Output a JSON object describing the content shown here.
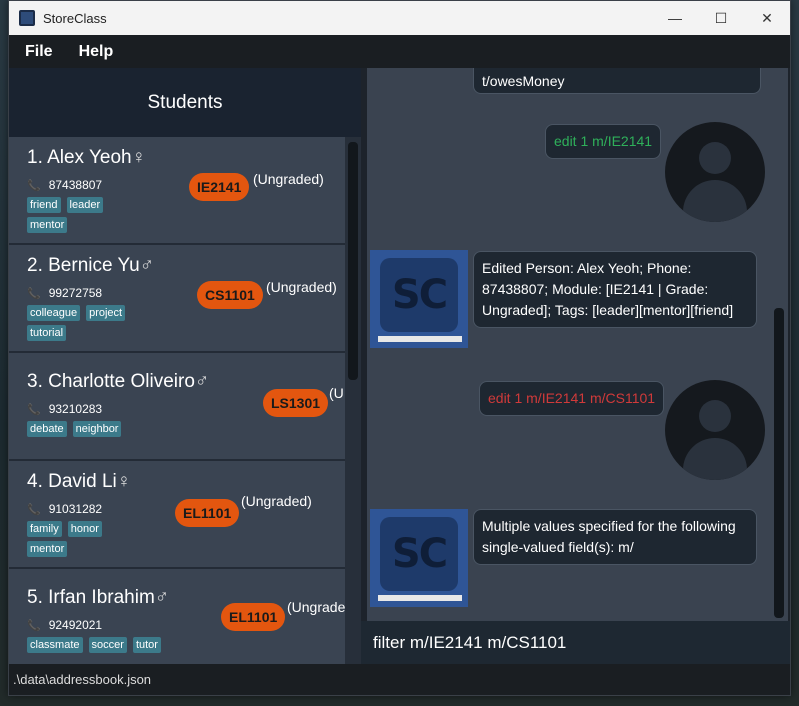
{
  "window": {
    "title": "StoreClass",
    "minimize": "—",
    "maximize": "☐",
    "close": "✕"
  },
  "menu": {
    "file": "File",
    "help": "Help"
  },
  "left": {
    "header": "Students"
  },
  "students": [
    {
      "name": "1. Alex Yeoh",
      "gender": "♀",
      "phone": "87438807",
      "tags": [
        "friend",
        "leader",
        "mentor"
      ],
      "module": "IE2141",
      "grade": "(Ungraded)"
    },
    {
      "name": "2. Bernice Yu",
      "gender": "♂",
      "phone": "99272758",
      "tags": [
        "colleague",
        "project",
        "tutorial"
      ],
      "module": "CS1101",
      "grade": "(Ungraded)"
    },
    {
      "name": "3. Charlotte Oliveiro",
      "gender": "♂",
      "phone": "93210283",
      "tags": [
        "debate",
        "neighbor"
      ],
      "module": "LS1301",
      "grade": "(U"
    },
    {
      "name": "4. David Li",
      "gender": "♀",
      "phone": "91031282",
      "tags": [
        "family",
        "honor",
        "mentor"
      ],
      "module": "EL1101",
      "grade": "(Ungraded)"
    },
    {
      "name": "5. Irfan Ibrahim",
      "gender": "♂",
      "phone": "92492021",
      "tags": [
        "classmate",
        "soccer",
        "tutor"
      ],
      "module": "EL1101",
      "grade": "(Ungrade"
    }
  ],
  "chat": {
    "msg_top": "t/owesMoney",
    "user1": "edit 1 m/IE2141",
    "bot1": "Edited Person: Alex Yeoh; Phone: 87438807; Module: [IE2141 | Grade: Ungraded]; Tags: [leader][mentor][friend]",
    "user2": "edit 1 m/IE2141 m/CS1101",
    "bot2": "Multiple values specified for the following single-valued field(s): m/",
    "sc_logo": "SC"
  },
  "command": {
    "value": "filter m/IE2141 m/CS1101"
  },
  "status": {
    "path": ".\\data\\addressbook.json"
  },
  "colors": {
    "module_badge": "#e3560f",
    "user_ok": "#2fb05a",
    "user_error": "#d03a3a"
  }
}
